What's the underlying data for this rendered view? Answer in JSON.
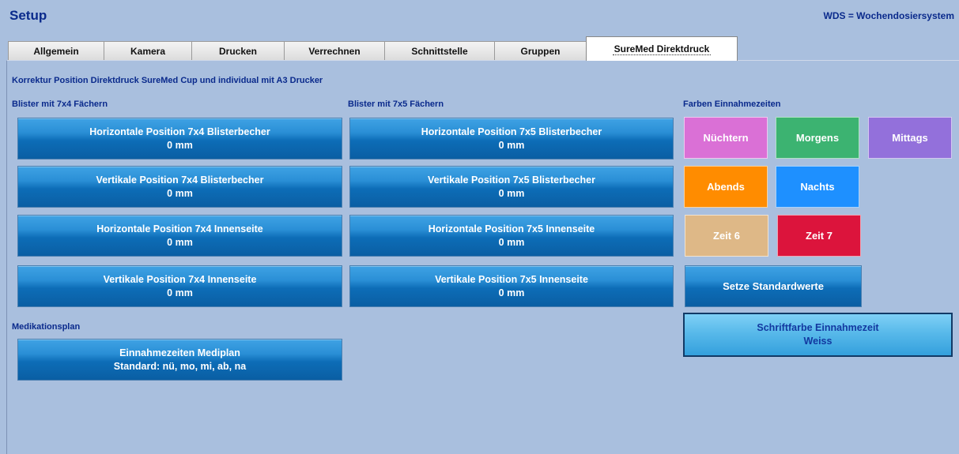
{
  "window": {
    "title": "Setup",
    "note": "WDS = Wochendosiersystem"
  },
  "tabs": [
    {
      "label": "Allgemein"
    },
    {
      "label": "Kamera"
    },
    {
      "label": "Drucken"
    },
    {
      "label": "Verrechnen"
    },
    {
      "label": "Schnittstelle"
    },
    {
      "label": "Gruppen"
    },
    {
      "label": "SureMed Direktdruck",
      "active": true
    }
  ],
  "main": {
    "heading": "Korrektur Position Direktdruck SureMed Cup und individual mit A3 Drucker",
    "blister7x4": {
      "title": "Blister mit 7x4 Fächern",
      "buttons": [
        {
          "label": "Horizontale Position 7x4 Blisterbecher",
          "value": "0 mm"
        },
        {
          "label": "Vertikale Position 7x4 Blisterbecher",
          "value": "0 mm"
        },
        {
          "label": "Horizontale Position 7x4 Innenseite",
          "value": "0 mm"
        },
        {
          "label": "Vertikale Position 7x4 Innenseite",
          "value": "0 mm"
        }
      ]
    },
    "blister7x5": {
      "title": "Blister mit 7x5 Fächern",
      "buttons": [
        {
          "label": "Horizontale Position 7x5 Blisterbecher",
          "value": "0 mm"
        },
        {
          "label": "Vertikale Position 7x5 Blisterbecher",
          "value": "0 mm"
        },
        {
          "label": "Horizontale Position 7x5 Innenseite",
          "value": "0 mm"
        },
        {
          "label": "Vertikale Position 7x5 Innenseite",
          "value": "0 mm"
        }
      ]
    },
    "medikationsplan": {
      "title": "Medikationsplan",
      "button": {
        "label": "Einnahmezeiten Mediplan",
        "value": "Standard: nü, mo, mi, ab, na"
      }
    },
    "farben": {
      "title": "Farben Einnahmezeiten",
      "items": [
        {
          "label": "Nüchtern",
          "color": "#da70d6"
        },
        {
          "label": "Morgens",
          "color": "#3cb371"
        },
        {
          "label": "Mittags",
          "color": "#9370db"
        },
        {
          "label": "Abends",
          "color": "#ff8c00"
        },
        {
          "label": "Nachts",
          "color": "#1e90ff"
        },
        {
          "label": "Zeit 6",
          "color": "#deb887"
        },
        {
          "label": "Zeit 7",
          "color": "#dc143c"
        }
      ],
      "reset_button": "Setze Standardwerte"
    },
    "schriftfarbe": {
      "label": "Schriftfarbe Einnahmezeit",
      "value": "Weiss"
    }
  }
}
